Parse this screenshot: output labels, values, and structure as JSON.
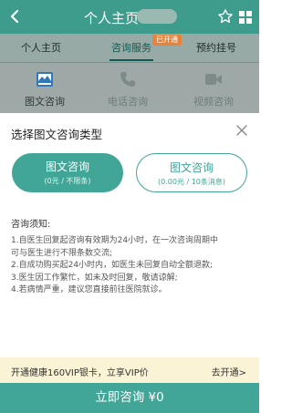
{
  "header": {
    "title": "个人主页-",
    "back_icon": "chevron-left-icon",
    "star_icon": "star-icon",
    "grid_icon": "grid-icon",
    "bg_color": "#3e9c8c"
  },
  "tabs": [
    {
      "label": "个人主页"
    },
    {
      "label": "咨询服务"
    },
    {
      "label": "预约挂号"
    }
  ],
  "tab_badge": "已开通",
  "services": [
    {
      "label": "图文咨询",
      "icon": "image-text-icon"
    },
    {
      "label": "电话咨询",
      "icon": "phone-icon"
    },
    {
      "label": "视频咨询",
      "icon": "video-icon"
    }
  ],
  "sheet": {
    "title": "选择图文咨询类型",
    "options": [
      {
        "label": "图文咨询",
        "sub": "(0元 / 不限条)",
        "selected": true
      },
      {
        "label": "图文咨询",
        "sub": "(0.00元 / 10条消息)",
        "selected": false
      }
    ],
    "notice_title": "咨询须知:",
    "notice_lines": [
      "1.自医生回复起咨询有效期为24小时，在一次咨询周期中",
      "可与医生进行不限条数交流;",
      "2.自成功购买起24小时内，如医生未回复自动全额退款;",
      "3.医生因工作繁忙，如未及时回复，敬请谅解;",
      "4.若病情严重，建议您直接前往医院就诊。"
    ]
  },
  "vip": {
    "text": "开通健康160VIP银卡，立享VIP价",
    "action": "去开通>"
  },
  "cta": {
    "label": "立即咨询 ¥0"
  },
  "colors": {
    "accent": "#41a597",
    "badge": "#e7833a",
    "vip_bg": "#fbf3d5"
  }
}
